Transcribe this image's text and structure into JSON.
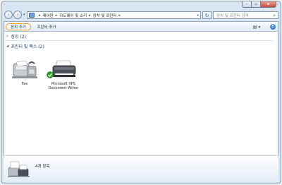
{
  "window": {
    "caption": {
      "minimize": "–",
      "maximize": "▫",
      "close": "x"
    }
  },
  "nav": {
    "back_glyph": "‹",
    "forward_glyph": "›",
    "address_crumbs": [
      "제어판",
      "하드웨어 및 소리",
      "장치 및 프린터"
    ],
    "search_placeholder": "장치 및 프린터 검색"
  },
  "toolbar": {
    "add_device": "장치 추가",
    "add_printer": "프린터 추가",
    "view_glyph": "▤ ▾",
    "help_glyph": "?"
  },
  "groups": [
    {
      "title": "장치 (2)",
      "expanded": false
    },
    {
      "title": "프린터 및 팩스 (2)",
      "expanded": true
    }
  ],
  "devices": [
    {
      "name": "Fax",
      "icon": "fax-icon"
    },
    {
      "name": "Microsoft XPS Document Writer",
      "icon": "printer-icon",
      "default": true
    }
  ],
  "status": {
    "item_count": "4개 항목"
  },
  "colors": {
    "accent_highlight": "#f0a020",
    "group_text": "#1e3a70",
    "default_check": "#2ea02e"
  }
}
